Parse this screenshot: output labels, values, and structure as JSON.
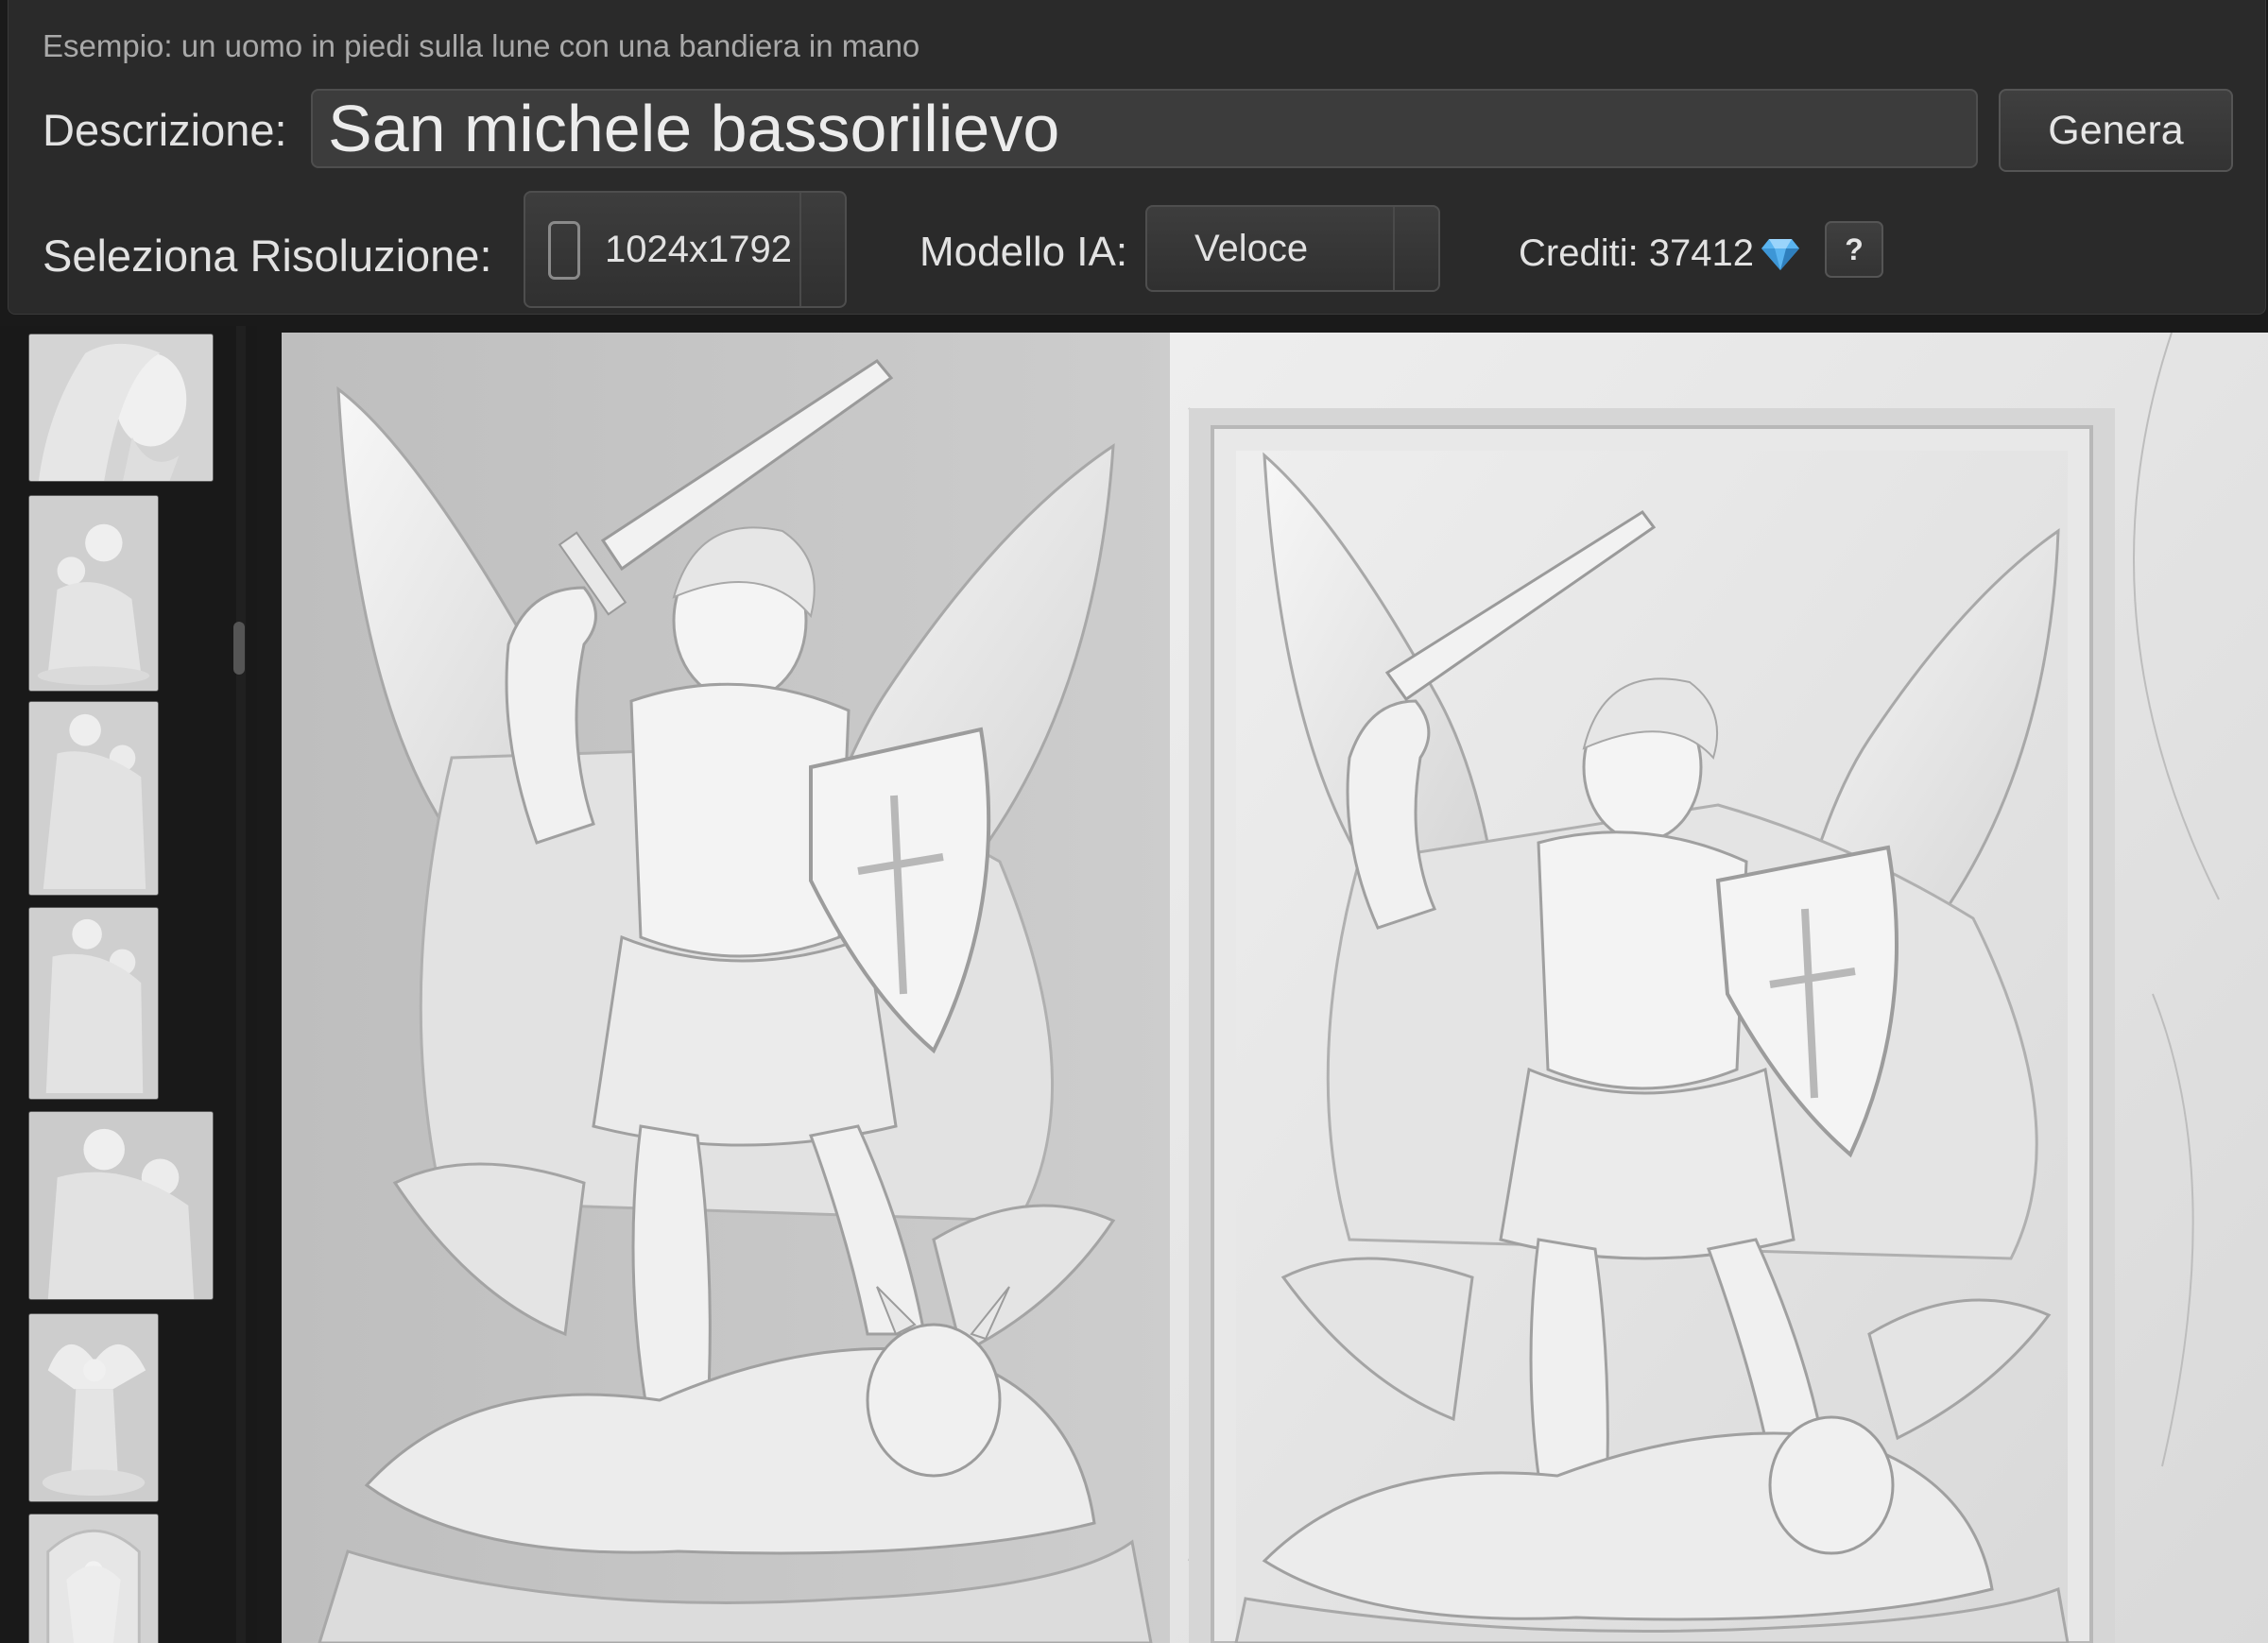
{
  "header": {
    "example_hint": "Esempio: un uomo in piedi sulla lune con una bandiera in mano",
    "description_label": "Descrizione:",
    "description_value": "San michele bassorilievo",
    "generate_label": "Genera",
    "resolution_label": "Seleziona Risoluzione:",
    "resolution_value": "1024x1792",
    "resolution_icon": "portrait-phone-icon",
    "model_label": "Modello IA:",
    "model_value": "Veloce",
    "credits_text": "Crediti: 37412",
    "credits_icon": "gem-icon",
    "help_label": "?"
  },
  "sidebar": {
    "thumbnails": [
      {
        "subject": "Christ head relief"
      },
      {
        "subject": "Saint Joseph with child relief"
      },
      {
        "subject": "Saint Joseph with child relief"
      },
      {
        "subject": "Saint Joseph with child relief"
      },
      {
        "subject": "Saint Joseph with child relief"
      },
      {
        "subject": "Saint Michael relief"
      },
      {
        "subject": "Saint Michael framed relief"
      }
    ]
  },
  "main": {
    "images": [
      {
        "subject": "Saint Michael bas-relief on grey background"
      },
      {
        "subject": "Saint Michael bas-relief in marble frame"
      }
    ]
  },
  "colors": {
    "panel_bg": "#2a2a2a",
    "page_bg": "#1a1a1a",
    "input_bg": "#3c3c3c",
    "gem": "#5ab4f0"
  }
}
